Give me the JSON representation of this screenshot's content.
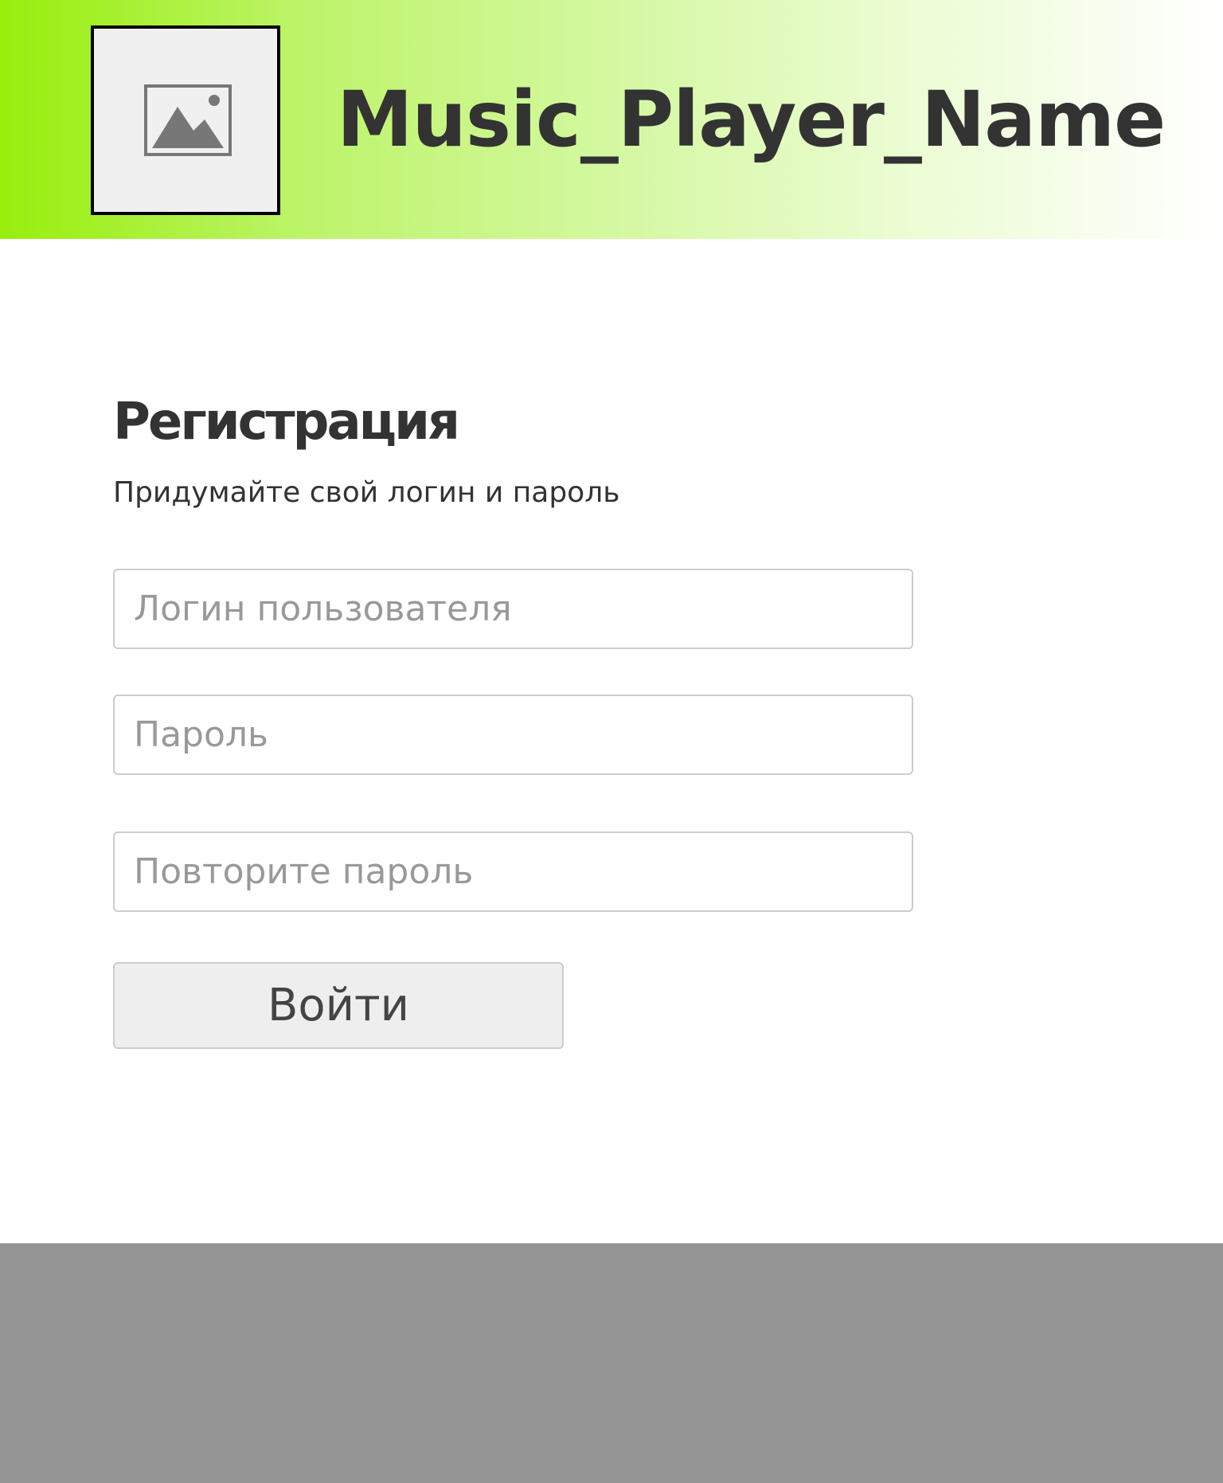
{
  "header": {
    "logo_icon": "image-placeholder-icon",
    "title": "Music_Player_Name"
  },
  "form": {
    "title": "Регистрация",
    "subtitle": "Придумайте свой логин и пароль",
    "login_placeholder": "Логин пользователя",
    "password_placeholder": "Пароль",
    "repeat_password_placeholder": "Повторите пароль",
    "submit_label": "Войти"
  },
  "colors": {
    "header_gradient_start": "#98ee0c",
    "header_gradient_end": "#ffffff",
    "text_dark": "#333333",
    "placeholder_text": "#999999",
    "input_border": "#cccccc",
    "button_bg": "#eeeeee",
    "footer_bg": "#949494"
  }
}
